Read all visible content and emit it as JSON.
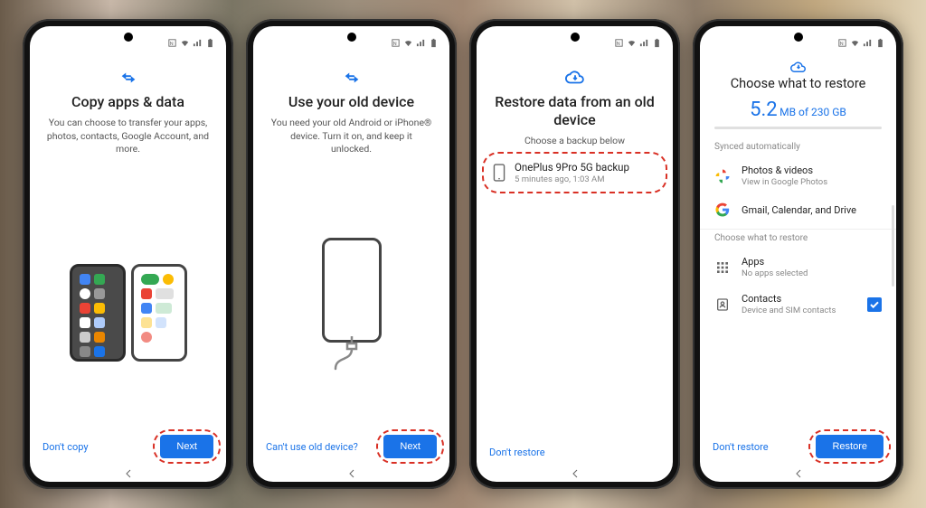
{
  "screen1": {
    "title": "Copy apps & data",
    "subtitle": "You can choose to transfer your apps, photos, contacts, Google Account, and more.",
    "secondary_link": "Don't copy",
    "primary_btn": "Next"
  },
  "screen2": {
    "title": "Use your old device",
    "subtitle": "You need your old Android or iPhone® device. Turn it on, and keep it unlocked.",
    "secondary_link": "Can't use old device?",
    "primary_btn": "Next"
  },
  "screen3": {
    "title": "Restore data from an old device",
    "subtitle": "Choose a backup below",
    "backup": {
      "name": "OnePlus 9Pro 5G backup",
      "when": "5 minutes ago, 1:03 AM"
    },
    "secondary_link": "Don't restore"
  },
  "screen4": {
    "title": "Choose what to restore",
    "metric_value": "5.2",
    "metric_unit": " MB of 230 GB",
    "section_synced": "Synced automatically",
    "row_photos": {
      "l1": "Photos & videos",
      "l2": "View in Google Photos"
    },
    "row_gmail": {
      "l1": "Gmail, Calendar, and Drive"
    },
    "section_choose": "Choose what to restore",
    "row_apps": {
      "l1": "Apps",
      "l2": "No apps selected"
    },
    "row_contacts": {
      "l1": "Contacts",
      "l2": "Device and SIM contacts"
    },
    "secondary_link": "Don't restore",
    "primary_btn": "Restore"
  }
}
